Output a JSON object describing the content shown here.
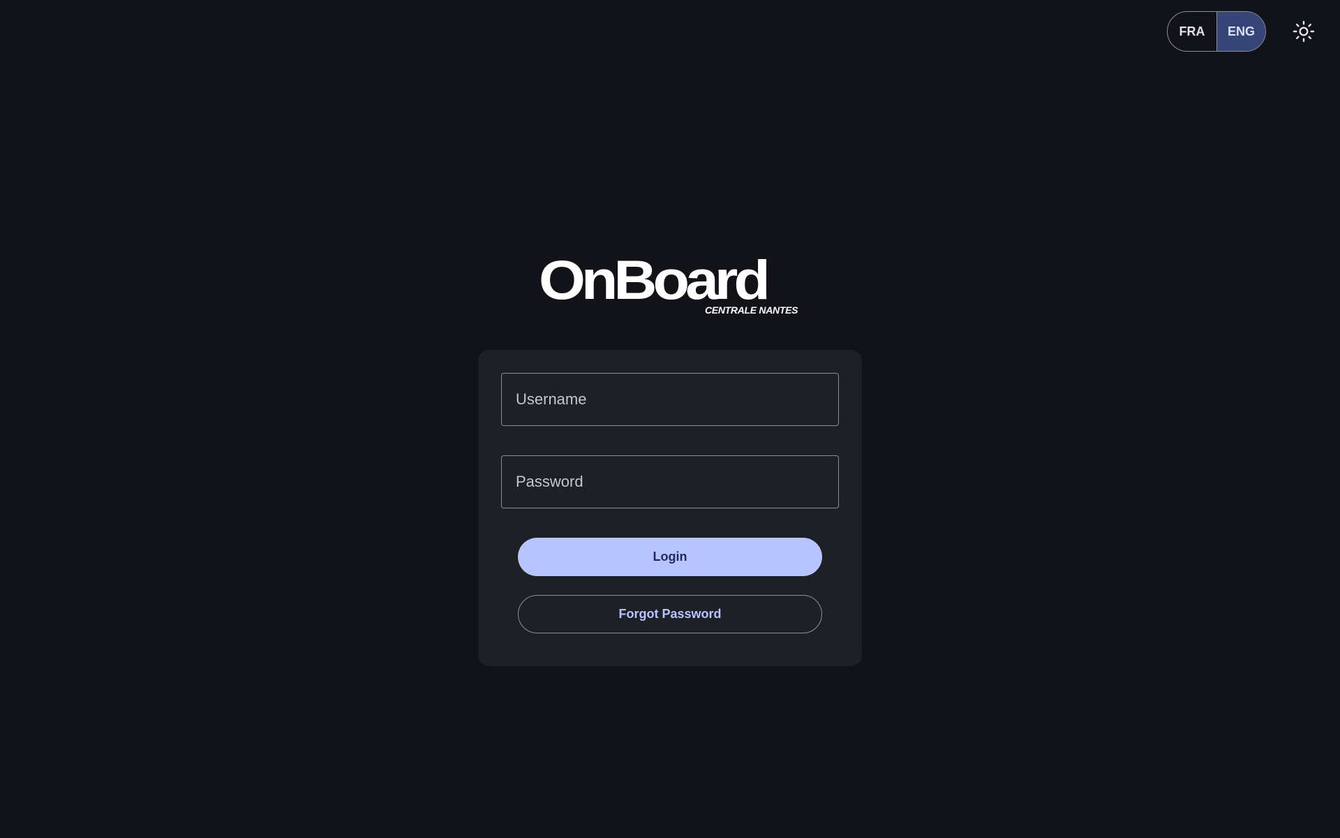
{
  "header": {
    "languages": [
      {
        "label": "FRA",
        "active": false
      },
      {
        "label": "ENG",
        "active": true
      }
    ],
    "theme_icon": "sun-icon"
  },
  "logo": {
    "title": "OnBoard",
    "subtitle": "CENTRALE NANTES"
  },
  "form": {
    "username_placeholder": "Username",
    "password_placeholder": "Password",
    "login_label": "Login",
    "forgot_label": "Forgot Password"
  },
  "colors": {
    "background": "#111318",
    "card": "#1d2024",
    "primary": "#b8c4ff",
    "active_lang": "#364476"
  }
}
